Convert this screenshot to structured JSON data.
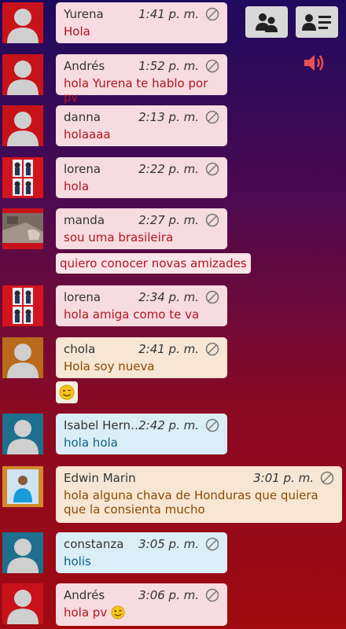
{
  "toolbar": {
    "users_button_icon": "users-icon",
    "user_list_button_icon": "user-list-icon",
    "sound_icon": "speaker-icon"
  },
  "messages": [
    {
      "name": "Yurena",
      "time": "1:41 p. m.",
      "text": "Hola"
    },
    {
      "name": "Andrés",
      "time": "1:52 p. m.",
      "text": "hola Yurena te hablo por pv"
    },
    {
      "name": "danna",
      "time": "2:13 p. m.",
      "text": "holaaaa"
    },
    {
      "name": "lorena",
      "time": "2:22 p. m.",
      "text": "hola"
    },
    {
      "name": "manda",
      "time": "2:27 p. m.",
      "text": "sou uma brasileira",
      "extra": "quiero conocer novas amizades"
    },
    {
      "name": "lorena",
      "time": "2:34 p. m.",
      "text": "hola amiga como te va"
    },
    {
      "name": "chola",
      "time": "2:41 p. m.",
      "text": "Hola soy nueva"
    },
    {
      "name": "Isabel Hern…",
      "time": "2:42 p. m.",
      "text": "hola hola"
    },
    {
      "name": "Edwin Marin",
      "time": "3:01 p. m.",
      "text": "hola alguna chava de Honduras que quiera que la consienta mucho"
    },
    {
      "name": "constanza",
      "time": "3:05 p. m.",
      "text": "holis"
    },
    {
      "name": "Andrés",
      "time": "3:06 p. m.",
      "text": "hola pv"
    }
  ],
  "colors": {
    "pink_bubble": "#f6dbe0",
    "cream_bubble": "#f7e6d4",
    "blue_bubble": "#d9eef6",
    "red_text": "#b3141e"
  }
}
